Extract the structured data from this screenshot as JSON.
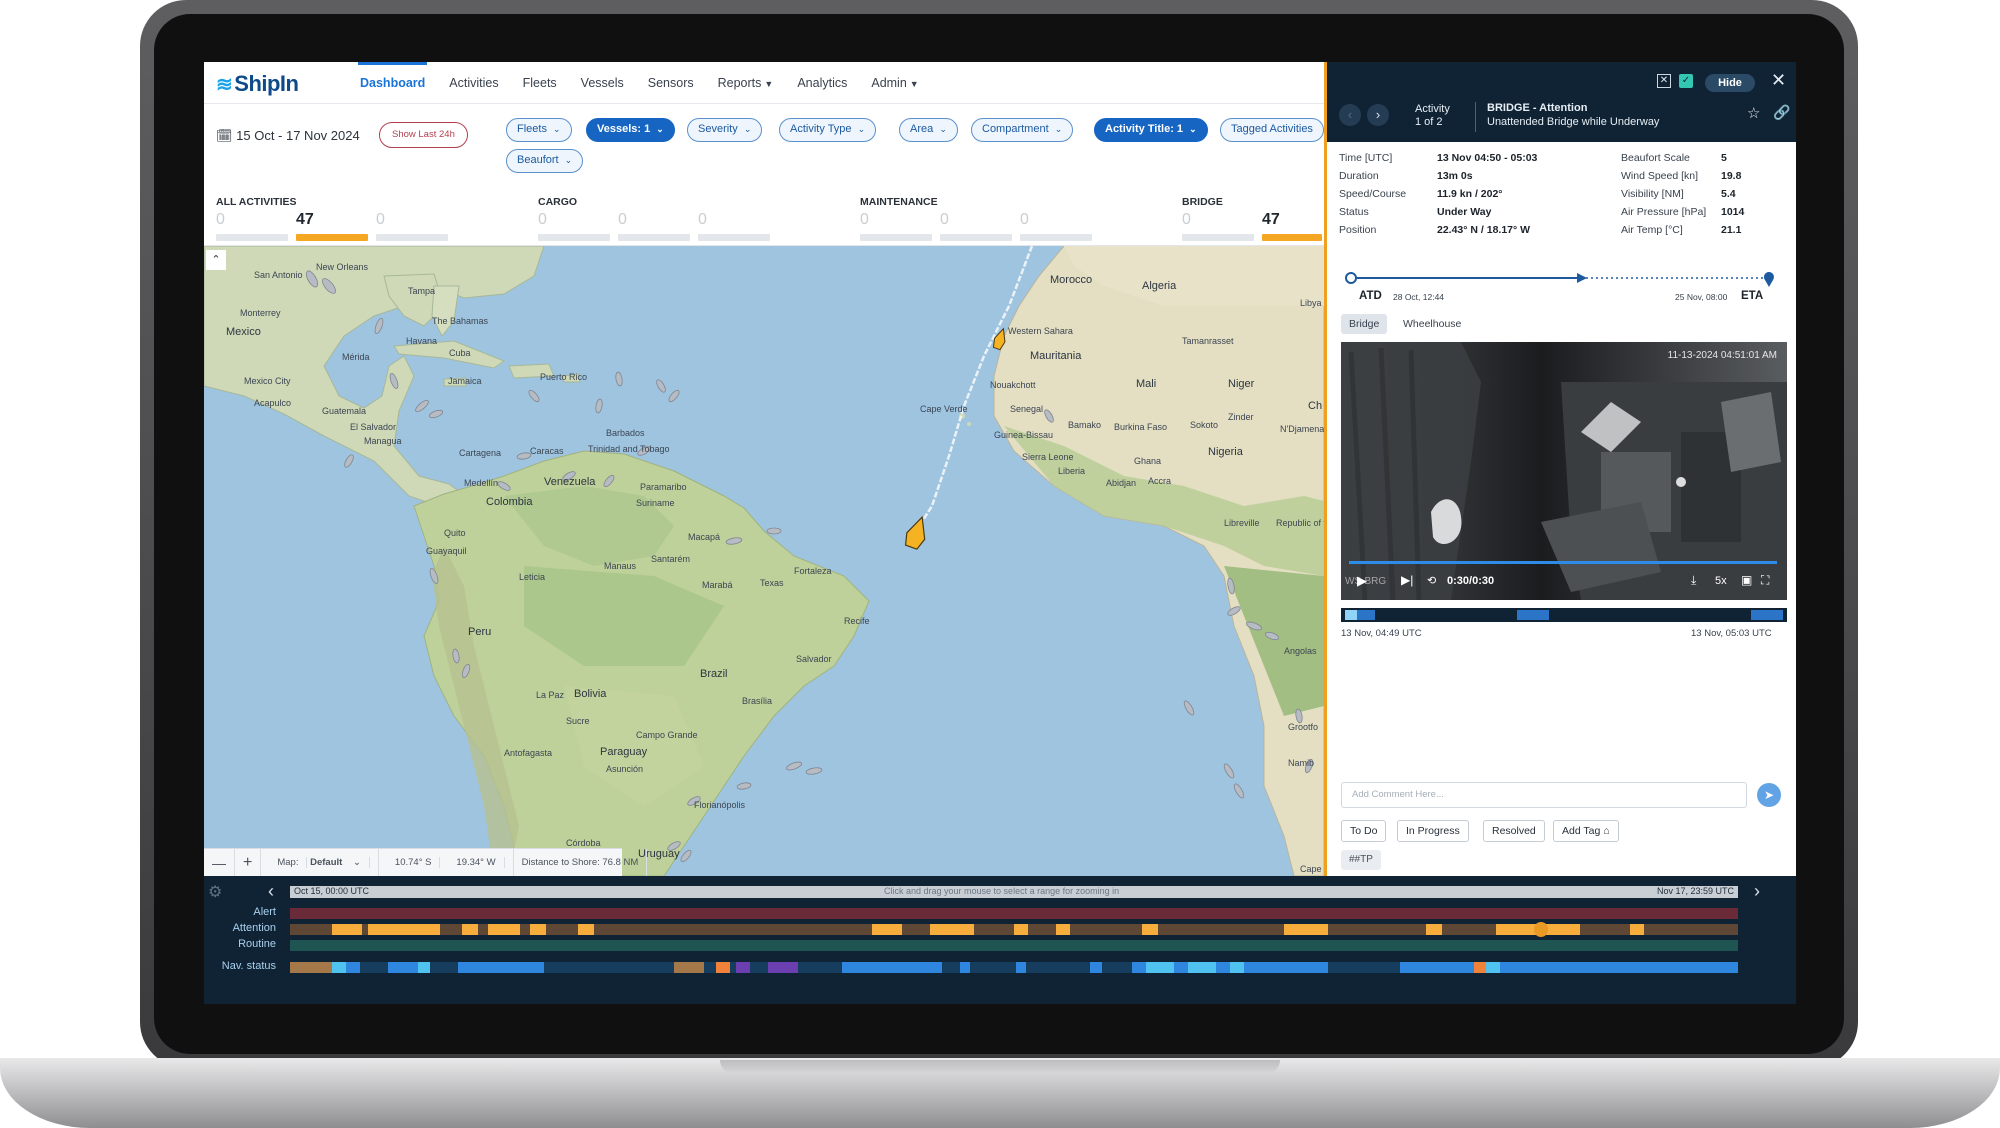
{
  "app": {
    "logo_text": "ShipIn"
  },
  "nav": [
    "Dashboard",
    "Activities",
    "Fleets",
    "Vessels",
    "Sensors",
    "Reports",
    "Analytics",
    "Admin"
  ],
  "filters": {
    "date_range": "15 Oct - 17 Nov 2024",
    "show_last": "Show Last 24h",
    "chips": [
      "Fleets",
      "Vessels: 1",
      "Severity",
      "Activity Type",
      "Area",
      "Compartment",
      "Activity Title: 1",
      "Tagged Activities",
      "Beaufort"
    ]
  },
  "counters": [
    {
      "title": "ALL ACTIVITIES",
      "values": [
        "0",
        "47",
        "0"
      ]
    },
    {
      "title": "CARGO",
      "values": [
        "0",
        "0",
        "0"
      ]
    },
    {
      "title": "MAINTENANCE",
      "values": [
        "0",
        "0",
        "0"
      ]
    },
    {
      "title": "BRIDGE",
      "values": [
        "0",
        "47"
      ]
    }
  ],
  "map": {
    "labels": {
      "san_antonio": "San Antonio",
      "new_orleans": "New Orleans",
      "tampa": "Tampa",
      "the_bahamas": "The Bahamas",
      "havana": "Havana",
      "cuba": "Cuba",
      "merida": "Mérida",
      "mexico": "Mexico",
      "monterrey": "Monterrey",
      "mexico_city": "Mexico City",
      "jamaica": "Jamaica",
      "puerto_rico": "Puerto Rico",
      "guatemala": "Guatemala",
      "el_salvador": "El Salvador",
      "managua": "Managua",
      "acapulco": "Acapulco",
      "barbados": "Barbados",
      "cartagena": "Cartagena",
      "caracas": "Caracas",
      "trinidad": "Trinidad and Tobago",
      "medellin": "Medellín",
      "venezuela": "Venezuela",
      "paramaribo": "Paramaribo",
      "suriname": "Suriname",
      "colombia": "Colombia",
      "quito": "Quito",
      "guayaquil": "Guayaquil",
      "macapa": "Macapá",
      "manaus": "Manaus",
      "santarem": "Santarém",
      "leticia": "Leticia",
      "fortaleza": "Fortaleza",
      "maraba": "Marabá",
      "texas": "Texas",
      "peru": "Peru",
      "recife": "Recife",
      "salvador": "Salvador",
      "brazil": "Brazil",
      "bolivia": "Bolivia",
      "la_paz": "La Paz",
      "sucre": "Sucre",
      "brasilia": "Brasília",
      "campo_grande": "Campo Grande",
      "paraguay": "Paraguay",
      "asuncion": "Asunción",
      "antofagasta": "Antofagasta",
      "florianopolis": "Florianópolis",
      "cordoba": "Córdoba",
      "uruguay": "Uruguay",
      "morocco": "Morocco",
      "algeria": "Algeria",
      "libya": "Libya",
      "western_sahara": "Western Sahara",
      "mauritania": "Mauritania",
      "tamanrasset": "Tamanrasset",
      "nouakchott": "Nouakchott",
      "mali": "Mali",
      "niger": "Niger",
      "cape_verde": "Cape Verde",
      "senegal": "Senegal",
      "zinder": "Zinder",
      "guinea_bissau": "Guinea-Bissau",
      "bamako": "Bamako",
      "burkina_faso": "Burkina Faso",
      "sokoto": "Sokoto",
      "ndjamena": "N'Djamena",
      "chad": "Ch",
      "sierra_leone": "Sierra Leone",
      "ghana": "Ghana",
      "nigeria": "Nigeria",
      "liberia": "Liberia",
      "abidjan": "Abidjan",
      "accra": "Accra",
      "libreville": "Libreville",
      "congo": "Republic of the Congo",
      "angola": "Angolas",
      "grootfontein": "Grootfo",
      "namibia": "Namib",
      "cape_town": "Cape"
    },
    "status": {
      "zoom_out": "—",
      "zoom_in": "+",
      "map_prefix": "Map:",
      "map_value": "Default",
      "coords_lat": "10.74° S",
      "coords_lon": "19.34° W",
      "distance": "Distance to Shore: 76.8 NM"
    }
  },
  "panel": {
    "hide": "Hide",
    "activity_label": "Activity",
    "activity_count": "1 of 2",
    "title": "BRIDGE - Attention",
    "subtitle": "Unattended Bridge while Underway",
    "details_left": [
      {
        "k": "Time [UTC]",
        "v": "13 Nov 04:50 - 05:03"
      },
      {
        "k": "Duration",
        "v": "13m 0s"
      },
      {
        "k": "Speed/Course",
        "v": "11.9 kn / 202°"
      },
      {
        "k": "Status",
        "v": "Under Way"
      },
      {
        "k": "Position",
        "v": "22.43° N / 18.17° W"
      }
    ],
    "details_right": [
      {
        "k": "Beaufort Scale",
        "v": "5"
      },
      {
        "k": "Wind Speed [kn]",
        "v": "19.8"
      },
      {
        "k": "Visibility [NM]",
        "v": "5.4"
      },
      {
        "k": "Air Pressure [hPa]",
        "v": "1014"
      },
      {
        "k": "Air Temp [°C]",
        "v": "21.1"
      }
    ],
    "route": {
      "atd": "ATD",
      "atd_date": "28 Oct, 12:44",
      "eta": "ETA",
      "eta_date": "25 Nov, 08:00"
    },
    "camera_tabs": [
      "Bridge",
      "Wheelhouse"
    ],
    "video": {
      "timestamp": "11-13-2024 04:51:01 AM",
      "time": "0:30/0:30",
      "speed": "5x",
      "watermark": "WS-BRG"
    },
    "clip_start": "13 Nov, 04:49 UTC",
    "clip_end": "13 Nov, 05:03 UTC",
    "comment_placeholder": "Add Comment Here...",
    "status_buttons": [
      "To Do",
      "In Progress",
      "Resolved",
      "Add Tag"
    ],
    "hashtag": "##TP"
  },
  "timeline": {
    "start": "Oct 15, 00:00 UTC",
    "end": "Nov 17, 23:59 UTC",
    "hint": "Click and drag your mouse to select a range for zooming in",
    "rows": [
      "Alert",
      "Attention",
      "Routine",
      "Nav. status"
    ]
  },
  "colors": {
    "accent": "#1a73d9",
    "attention": "#f5a623",
    "navy": "#0f2334",
    "alert_row": "#6b2a37",
    "attention_row": "#5e4735",
    "routine_row": "#1e5553"
  }
}
